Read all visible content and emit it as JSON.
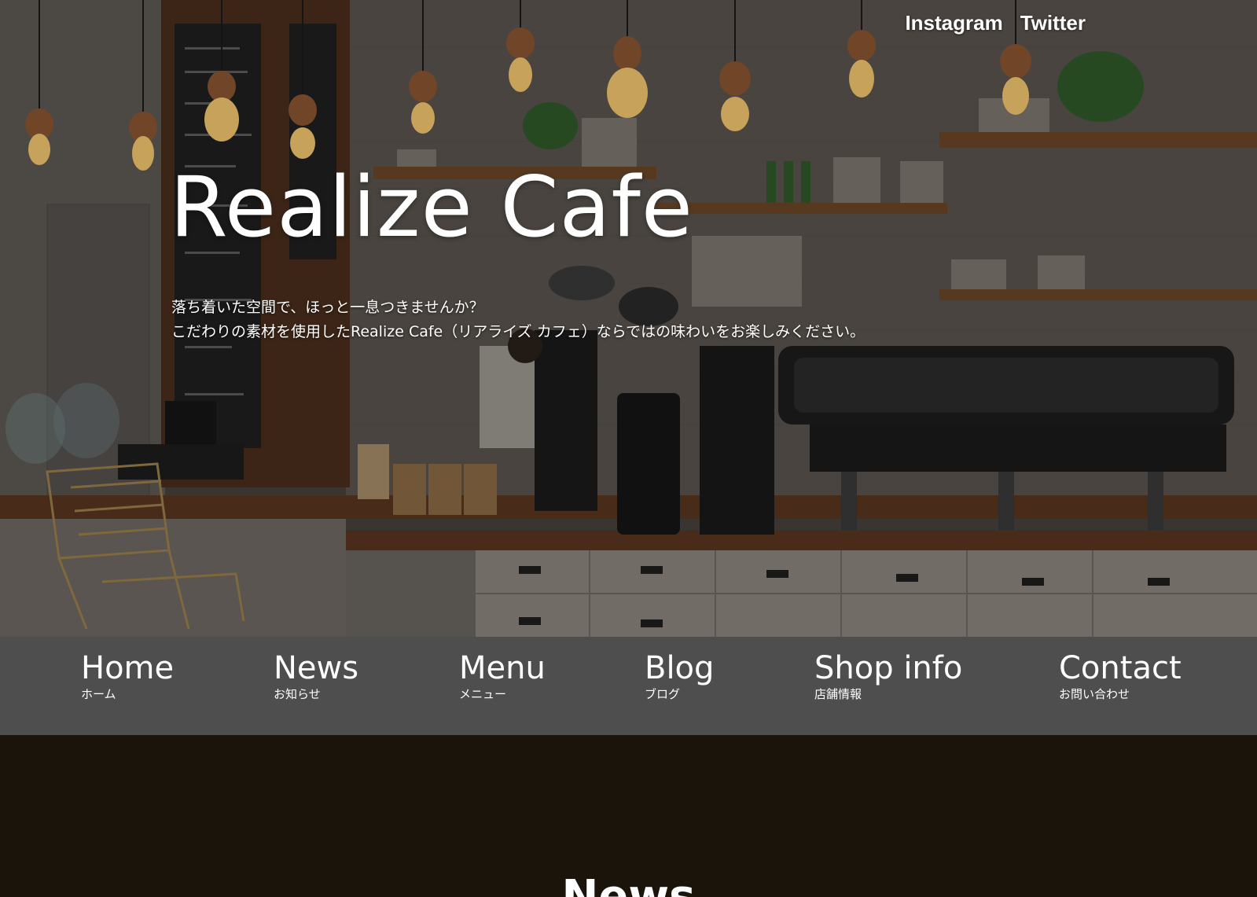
{
  "social": {
    "instagram": "Instagram",
    "twitter": "Twitter"
  },
  "hero": {
    "title": "Realize Cafe",
    "lead_line1": "落ち着いた空間で、ほっと一息つきませんか？",
    "lead_line2": "こだわりの素材を使用したRealize Cafe（リアライズ カフェ）ならではの味わいをお楽しみください。",
    "background": "cafe-counter-photo"
  },
  "nav": {
    "items": [
      {
        "en": "Home",
        "ja": "ホーム"
      },
      {
        "en": "News",
        "ja": "お知らせ"
      },
      {
        "en": "Menu",
        "ja": "メニュー"
      },
      {
        "en": "Blog",
        "ja": "ブログ"
      },
      {
        "en": "Shop info",
        "ja": "店舗情報"
      },
      {
        "en": "Contact",
        "ja": "お問い合わせ"
      }
    ]
  },
  "news": {
    "heading": "News"
  },
  "colors": {
    "nav_bg": "#4e4e4e",
    "section_bg": "#1b140b",
    "text": "#ffffff"
  }
}
